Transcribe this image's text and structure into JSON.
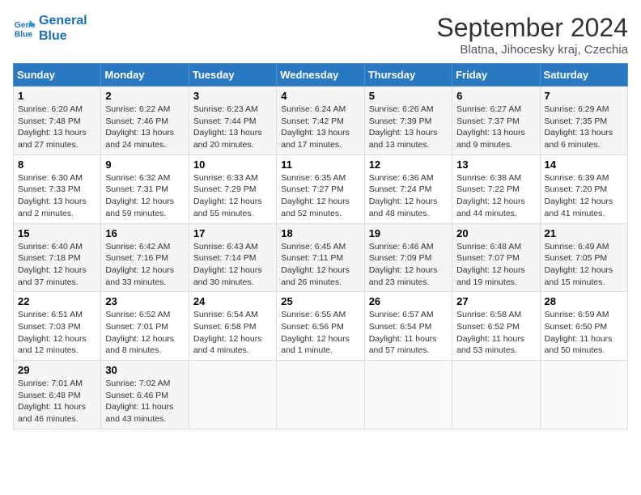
{
  "header": {
    "logo_line1": "General",
    "logo_line2": "Blue",
    "month": "September 2024",
    "location": "Blatna, Jihocesky kraj, Czechia"
  },
  "days_of_week": [
    "Sunday",
    "Monday",
    "Tuesday",
    "Wednesday",
    "Thursday",
    "Friday",
    "Saturday"
  ],
  "weeks": [
    [
      {
        "day": 1,
        "sunrise": "6:20 AM",
        "sunset": "7:48 PM",
        "daylight": "13 hours and 27 minutes."
      },
      {
        "day": 2,
        "sunrise": "6:22 AM",
        "sunset": "7:46 PM",
        "daylight": "13 hours and 24 minutes."
      },
      {
        "day": 3,
        "sunrise": "6:23 AM",
        "sunset": "7:44 PM",
        "daylight": "13 hours and 20 minutes."
      },
      {
        "day": 4,
        "sunrise": "6:24 AM",
        "sunset": "7:42 PM",
        "daylight": "13 hours and 17 minutes."
      },
      {
        "day": 5,
        "sunrise": "6:26 AM",
        "sunset": "7:39 PM",
        "daylight": "13 hours and 13 minutes."
      },
      {
        "day": 6,
        "sunrise": "6:27 AM",
        "sunset": "7:37 PM",
        "daylight": "13 hours and 9 minutes."
      },
      {
        "day": 7,
        "sunrise": "6:29 AM",
        "sunset": "7:35 PM",
        "daylight": "13 hours and 6 minutes."
      }
    ],
    [
      {
        "day": 8,
        "sunrise": "6:30 AM",
        "sunset": "7:33 PM",
        "daylight": "13 hours and 2 minutes."
      },
      {
        "day": 9,
        "sunrise": "6:32 AM",
        "sunset": "7:31 PM",
        "daylight": "12 hours and 59 minutes."
      },
      {
        "day": 10,
        "sunrise": "6:33 AM",
        "sunset": "7:29 PM",
        "daylight": "12 hours and 55 minutes."
      },
      {
        "day": 11,
        "sunrise": "6:35 AM",
        "sunset": "7:27 PM",
        "daylight": "12 hours and 52 minutes."
      },
      {
        "day": 12,
        "sunrise": "6:36 AM",
        "sunset": "7:24 PM",
        "daylight": "12 hours and 48 minutes."
      },
      {
        "day": 13,
        "sunrise": "6:38 AM",
        "sunset": "7:22 PM",
        "daylight": "12 hours and 44 minutes."
      },
      {
        "day": 14,
        "sunrise": "6:39 AM",
        "sunset": "7:20 PM",
        "daylight": "12 hours and 41 minutes."
      }
    ],
    [
      {
        "day": 15,
        "sunrise": "6:40 AM",
        "sunset": "7:18 PM",
        "daylight": "12 hours and 37 minutes."
      },
      {
        "day": 16,
        "sunrise": "6:42 AM",
        "sunset": "7:16 PM",
        "daylight": "12 hours and 33 minutes."
      },
      {
        "day": 17,
        "sunrise": "6:43 AM",
        "sunset": "7:14 PM",
        "daylight": "12 hours and 30 minutes."
      },
      {
        "day": 18,
        "sunrise": "6:45 AM",
        "sunset": "7:11 PM",
        "daylight": "12 hours and 26 minutes."
      },
      {
        "day": 19,
        "sunrise": "6:46 AM",
        "sunset": "7:09 PM",
        "daylight": "12 hours and 23 minutes."
      },
      {
        "day": 20,
        "sunrise": "6:48 AM",
        "sunset": "7:07 PM",
        "daylight": "12 hours and 19 minutes."
      },
      {
        "day": 21,
        "sunrise": "6:49 AM",
        "sunset": "7:05 PM",
        "daylight": "12 hours and 15 minutes."
      }
    ],
    [
      {
        "day": 22,
        "sunrise": "6:51 AM",
        "sunset": "7:03 PM",
        "daylight": "12 hours and 12 minutes."
      },
      {
        "day": 23,
        "sunrise": "6:52 AM",
        "sunset": "7:01 PM",
        "daylight": "12 hours and 8 minutes."
      },
      {
        "day": 24,
        "sunrise": "6:54 AM",
        "sunset": "6:58 PM",
        "daylight": "12 hours and 4 minutes."
      },
      {
        "day": 25,
        "sunrise": "6:55 AM",
        "sunset": "6:56 PM",
        "daylight": "12 hours and 1 minute."
      },
      {
        "day": 26,
        "sunrise": "6:57 AM",
        "sunset": "6:54 PM",
        "daylight": "11 hours and 57 minutes."
      },
      {
        "day": 27,
        "sunrise": "6:58 AM",
        "sunset": "6:52 PM",
        "daylight": "11 hours and 53 minutes."
      },
      {
        "day": 28,
        "sunrise": "6:59 AM",
        "sunset": "6:50 PM",
        "daylight": "11 hours and 50 minutes."
      }
    ],
    [
      {
        "day": 29,
        "sunrise": "7:01 AM",
        "sunset": "6:48 PM",
        "daylight": "11 hours and 46 minutes."
      },
      {
        "day": 30,
        "sunrise": "7:02 AM",
        "sunset": "6:46 PM",
        "daylight": "11 hours and 43 minutes."
      },
      null,
      null,
      null,
      null,
      null
    ]
  ]
}
